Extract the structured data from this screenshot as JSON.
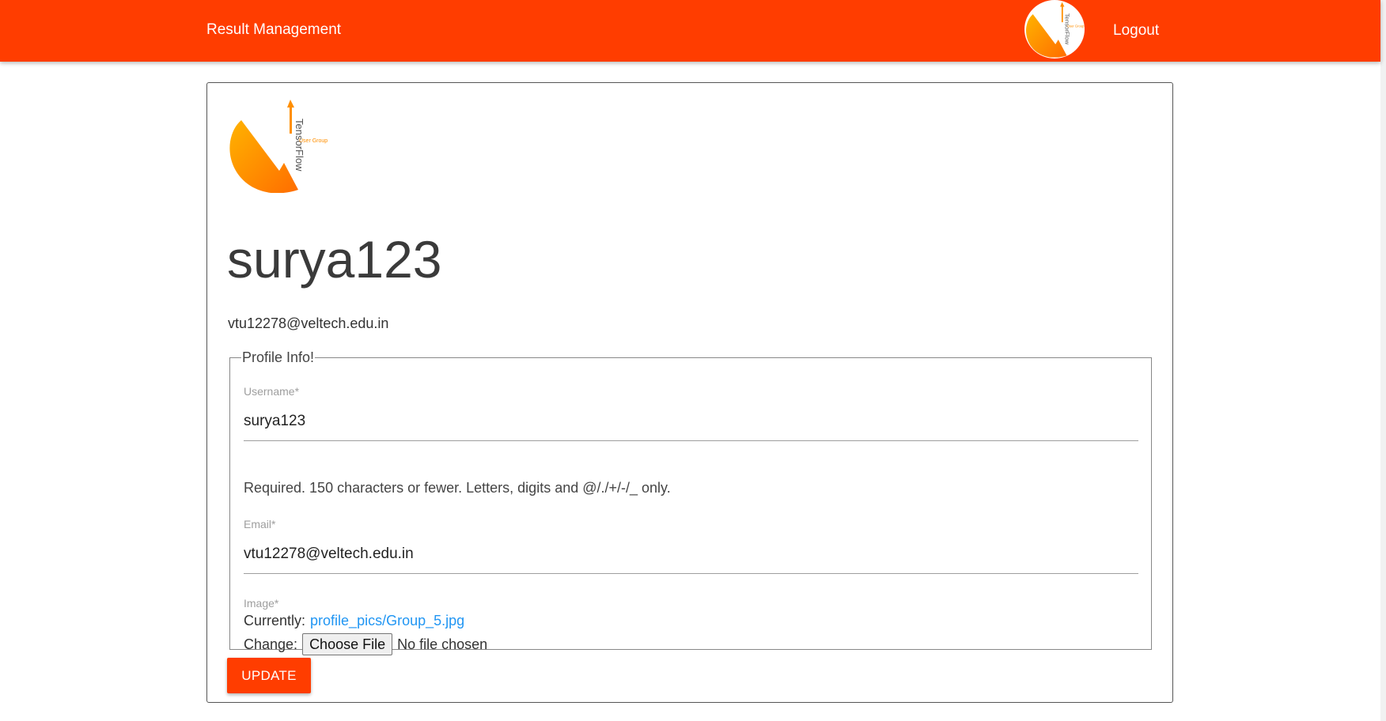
{
  "navbar": {
    "brand": "Result Management",
    "logout_label": "Logout",
    "avatar_icon": "tensorflow-logo-icon"
  },
  "profile": {
    "logo_icon": "tensorflow-logo-icon",
    "username": "surya123",
    "email": "vtu12278@veltech.edu.in"
  },
  "form": {
    "legend": "Profile Info!",
    "username_label": "Username*",
    "username_value": "surya123",
    "username_help": "Required. 150 characters or fewer. Letters, digits and @/./+/-/_ only.",
    "email_label": "Email*",
    "email_value": "vtu12278@veltech.edu.in",
    "image_label": "Image*",
    "image_currently_label": "Currently:",
    "image_current_file": "profile_pics/Group_5.jpg",
    "image_change_label": "Change:",
    "choose_file_label": "Choose File",
    "no_file_text": "No file chosen",
    "submit_label": "UPDATE"
  },
  "colors": {
    "primary": "#ff3d00",
    "link": "#2196f3"
  }
}
